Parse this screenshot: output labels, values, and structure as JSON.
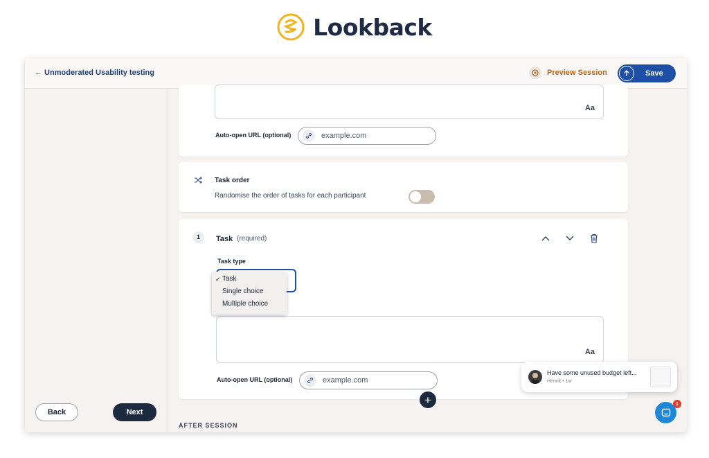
{
  "brand": {
    "name": "Lookback",
    "logo_icon": "spiral-logo-icon",
    "logo_color": "#f2b21b"
  },
  "header": {
    "back_label": "← Unmoderated Usability testing",
    "preview_label": "Preview Session",
    "save_label": "Save"
  },
  "sidebar": {
    "back_label": "Back",
    "next_label": "Next"
  },
  "intro_card": {
    "text_icon": "Aa",
    "url_label": "Auto-open URL (optional)",
    "url_placeholder": "example.com"
  },
  "task_order": {
    "title": "Task order",
    "description": "Randomise the order of tasks for each participant",
    "randomise_enabled": false
  },
  "task": {
    "number": "1",
    "title": "Task",
    "required_label": "(required)",
    "type_label": "Task type",
    "type_options": [
      {
        "label": "Task",
        "selected": true
      },
      {
        "label": "Single choice",
        "selected": false
      },
      {
        "label": "Multiple choice",
        "selected": false
      }
    ],
    "text_icon": "Aa",
    "url_label": "Auto-open URL (optional)",
    "url_placeholder": "example.com"
  },
  "section_after": "AFTER SESSION",
  "notification": {
    "message": "Have some unused budget left...",
    "meta": "Henrik • 1w",
    "unread_count": "1"
  },
  "colors": {
    "primary": "#1d4fa5",
    "dark": "#1c2a40",
    "accent": "#b3661a"
  }
}
